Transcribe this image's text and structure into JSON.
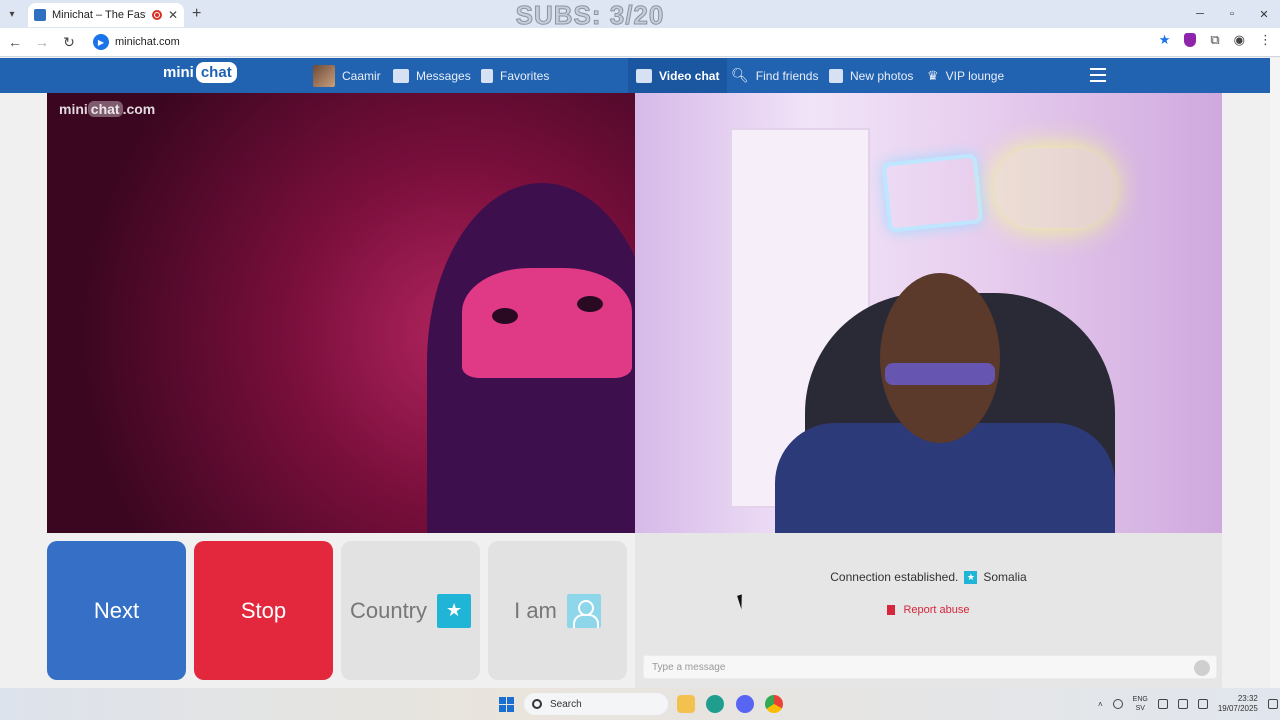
{
  "browser": {
    "tab_title": "Minichat – The Fast Video C",
    "url": "minichat.com",
    "overlay_text": "SUBS: 3/20"
  },
  "site": {
    "logo_left": "mini",
    "logo_right": "chat",
    "nav": {
      "user": "Caamir",
      "messages": "Messages",
      "favorites": "Favorites",
      "video_chat": "Video chat",
      "find_friends": "Find friends",
      "new_photos": "New photos",
      "vip_lounge": "VIP lounge"
    },
    "watermark_left": "mini",
    "watermark_mid": "chat",
    "watermark_right": ".com"
  },
  "controls": {
    "next": "Next",
    "stop": "Stop",
    "country": "Country",
    "iam": "I am"
  },
  "chat": {
    "status": "Connection established.",
    "country": "Somalia",
    "report": "Report abuse",
    "placeholder": "Type a message"
  },
  "taskbar": {
    "search": "Search",
    "lang_top": "ENG",
    "lang_bottom": "SV",
    "time": "23:32",
    "date": "19/07/2025"
  },
  "colors": {
    "header": "#2163b1",
    "next": "#3570c6",
    "stop": "#e3283e",
    "country_flag": "#20b5d6"
  }
}
